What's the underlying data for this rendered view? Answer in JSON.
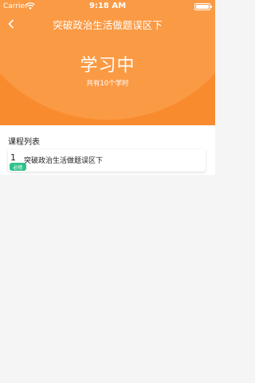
{
  "status_bar": {
    "carrier": "Carrier",
    "time": "9:18 AM",
    "wifi_icon": "wifi-icon",
    "battery_icon": "battery-icon",
    "battery_level": 1.0
  },
  "nav": {
    "back_icon": "chevron-left-icon",
    "title": "突破政治生活做题误区下"
  },
  "hero": {
    "title": "学习中",
    "subtitle": "共有10个学时",
    "color": "#f98b2f"
  },
  "course_list": {
    "title": "课程列表",
    "items": [
      {
        "index": "1",
        "name": "突破政治生活做题误区下",
        "badge": "必修",
        "badge_color": "#2fc38a"
      }
    ]
  }
}
